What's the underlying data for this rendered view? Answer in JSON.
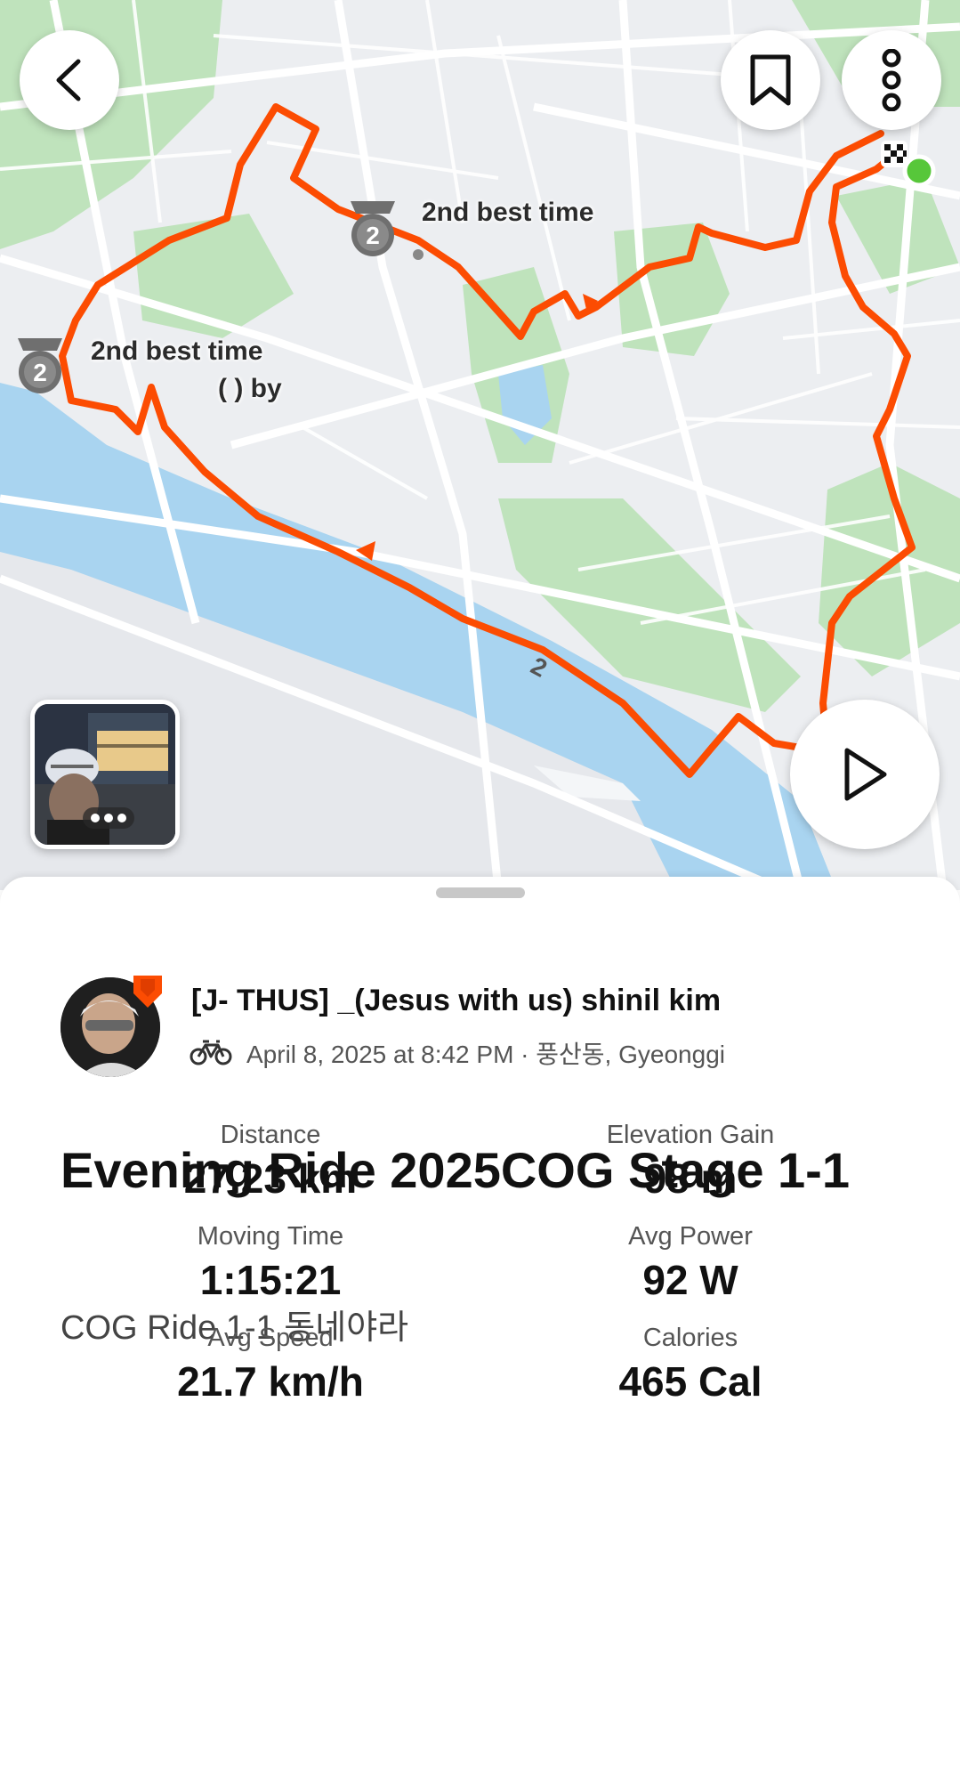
{
  "map": {
    "badge_best_label_1": "2nd best time",
    "badge_best_label_2": "2nd best time",
    "badge_sub_label": "(          ) by",
    "route_marker": "2",
    "badge_rank": "2",
    "route_color": "#fc4c02"
  },
  "toolbar": {
    "back_icon": "chevron-left-icon",
    "bookmark_icon": "bookmark-icon",
    "more_icon": "more-vertical-icon",
    "play_icon": "play-icon"
  },
  "athlete": {
    "name": "[J- THUS] _(Jesus with us) shinil kim",
    "meta": "April 8, 2025 at 8:42 PM · 풍산동, Gyeonggi",
    "activity_icon": "bike-icon"
  },
  "activity": {
    "title": "Evening Ride 2025COG Stage 1-1",
    "description": "COG Ride 1-1 동네야라"
  },
  "stats": [
    {
      "label": "Distance",
      "value": "27.23 km"
    },
    {
      "label": "Elevation Gain",
      "value": "98 m"
    },
    {
      "label": "Moving Time",
      "value": "1:15:21"
    },
    {
      "label": "Avg Power",
      "value": "92 W"
    },
    {
      "label": "Avg Speed",
      "value": "21.7 km/h"
    },
    {
      "label": "Calories",
      "value": "465 Cal"
    }
  ]
}
